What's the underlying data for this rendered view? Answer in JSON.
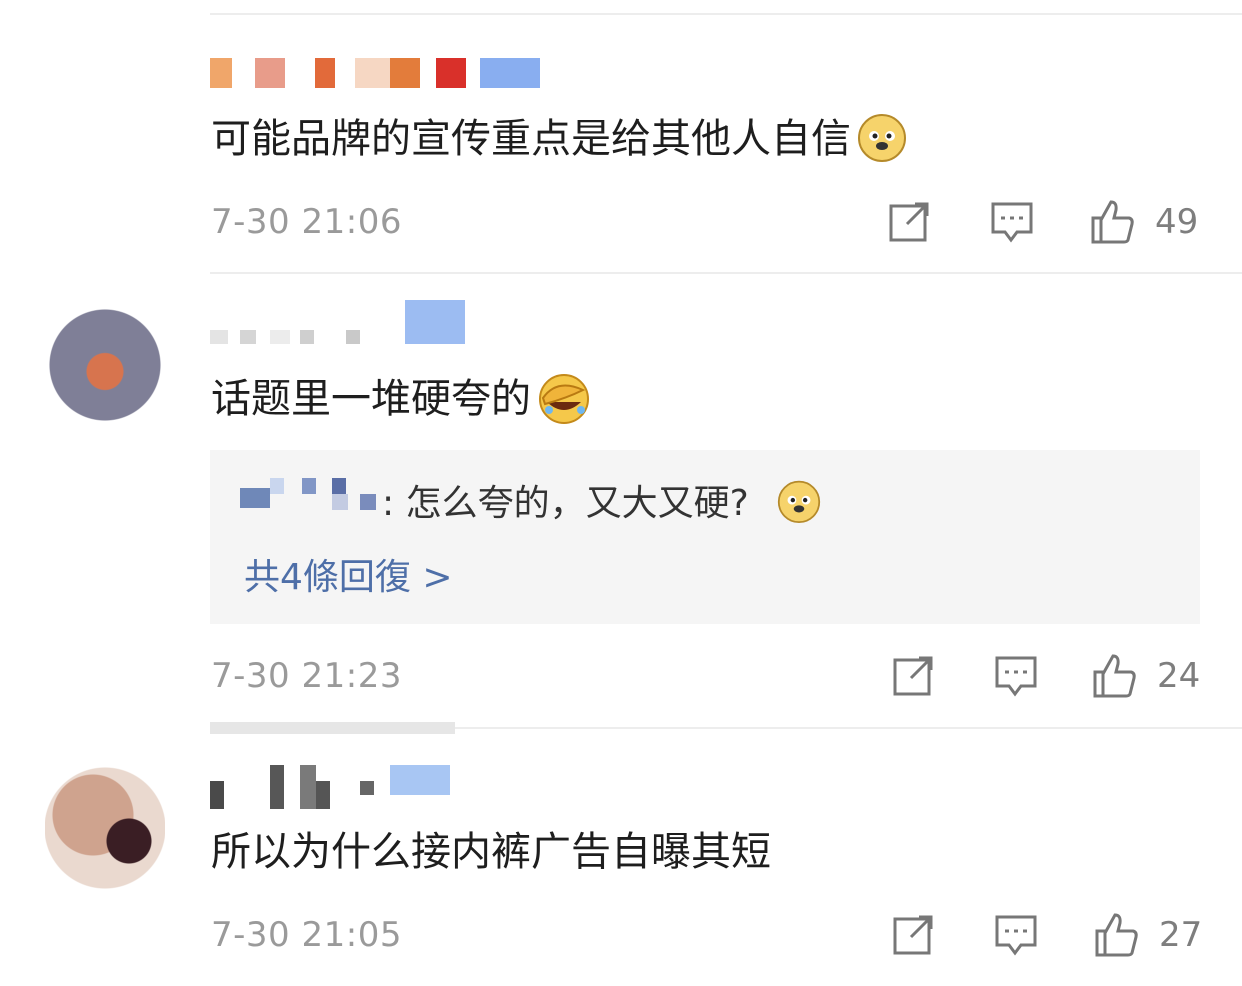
{
  "comments": [
    {
      "user_name": "",
      "text": "可能品牌的宣传重点是给其他人自信",
      "emoji": "doge-emoji",
      "time": "7-30 21:06",
      "likes": "49"
    },
    {
      "user_name": "",
      "text": "话题里一堆硬夸的",
      "emoji": "facepalm-laugh-emoji",
      "time": "7-30 21:23",
      "likes": "24",
      "reply_preview": {
        "text": ": 怎么夸的，又大又硬?",
        "emoji": "doge-emoji",
        "more_link": "共4條回復 >"
      }
    },
    {
      "user_name": "",
      "text": "所以为什么接内裤广告自曝其短",
      "time": "7-30 21:05",
      "likes": "27"
    }
  ],
  "icons": {
    "share": "share-icon",
    "comment": "comment-icon",
    "like": "thumbs-up-icon"
  },
  "colors": {
    "link": "#4e6fa8",
    "meta": "#9a9a9a",
    "divider": "#ededed",
    "reply_bg": "#f5f5f5"
  }
}
